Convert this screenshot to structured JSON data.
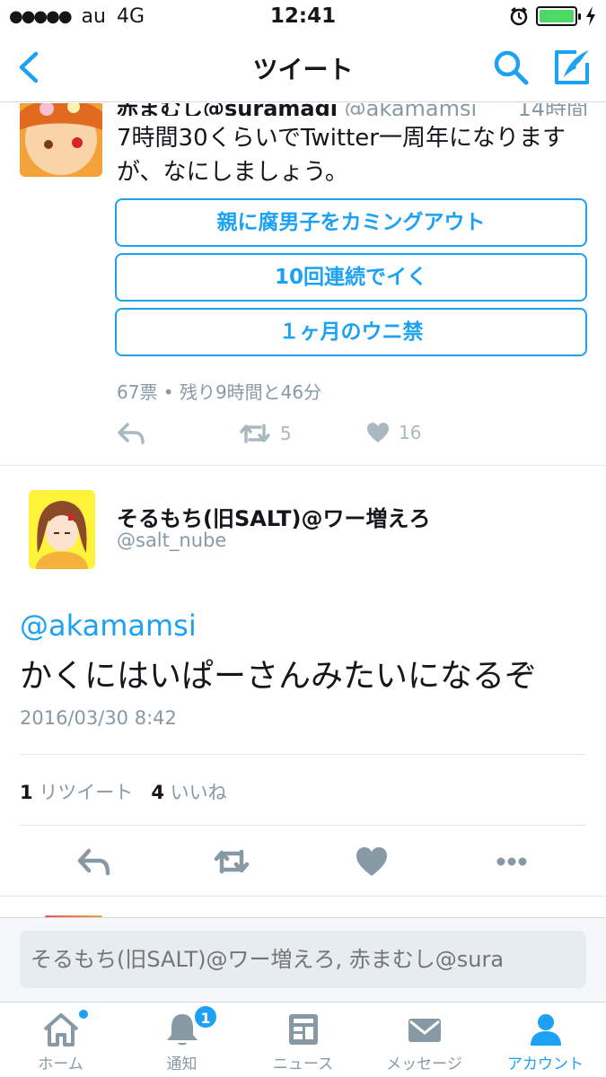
{
  "status_bar": {
    "signal": "●●●●●",
    "carrier": "au",
    "network": "4G",
    "time": "12:41"
  },
  "nav": {
    "title": "ツイート"
  },
  "poll_tweet": {
    "author_name": "赤まむし@suramagi",
    "handle": "@akamamsi",
    "time": "14時間",
    "text": "7時間30くらいでTwitter一周年になりますが、なにしましょう。",
    "options": [
      "親に腐男子をカミングアウト",
      "10回連続でイく",
      "１ヶ月のウニ禁"
    ],
    "meta": "67票 • 残り9時間と46分",
    "retweets": "5",
    "likes": "16"
  },
  "main_tweet": {
    "author_name": "そるもち(旧SALT)@ワー増えろ",
    "handle": "@salt_nube",
    "mention": "@akamamsi",
    "text": "かくにはいぱーさんみたいになるぞ",
    "date": "2016/03/30 8:42",
    "retweet_count": "1",
    "retweet_label": "リツイート",
    "like_count": "4",
    "like_label": "いいね"
  },
  "reply": {
    "placeholder": "そるもち(旧SALT)@ワー増えろ, 赤まむし@sura"
  },
  "tabs": [
    {
      "label": "ホーム",
      "icon": "home-icon"
    },
    {
      "label": "通知",
      "icon": "bell-icon",
      "badge": "1"
    },
    {
      "label": "ニュース",
      "icon": "news-icon"
    },
    {
      "label": "メッセージ",
      "icon": "envelope-icon"
    },
    {
      "label": "アカウント",
      "icon": "person-icon"
    }
  ],
  "colors": {
    "accent": "#1da1f2",
    "muted": "#8899a6",
    "battery": "#4cd964"
  }
}
